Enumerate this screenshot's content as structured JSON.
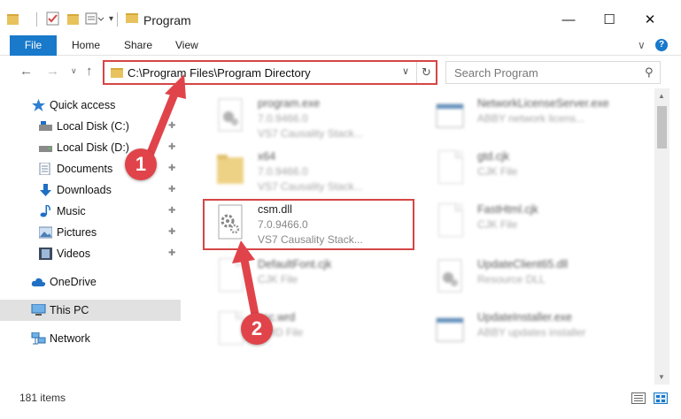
{
  "window": {
    "title": "Program",
    "minimize_label": "—",
    "maximize_label": "☐",
    "close_label": "✕"
  },
  "ribbon": {
    "file_label": "File",
    "tabs": [
      "Home",
      "Share",
      "View"
    ],
    "expand_label": "∨",
    "help_label": "?"
  },
  "nav": {
    "back_label": "←",
    "forward_label": "→",
    "recent_label": "∨",
    "up_label": "↑",
    "address": "C:\\Program Files\\Program Directory",
    "dropdown_label": "∨",
    "refresh_label": "↻",
    "search_placeholder": "Search Program",
    "search_icon_label": "⚲"
  },
  "sidebar": {
    "items": [
      {
        "label": "Quick access",
        "icon": "star-icon"
      },
      {
        "label": "Local Disk (C:)",
        "icon": "drive-icon"
      },
      {
        "label": "Local Disk (D:)",
        "icon": "drive-icon"
      },
      {
        "label": "Documents",
        "icon": "documents-icon"
      },
      {
        "label": "Downloads",
        "icon": "download-icon"
      },
      {
        "label": "Music",
        "icon": "music-icon"
      },
      {
        "label": "Pictures",
        "icon": "pictures-icon"
      },
      {
        "label": "Videos",
        "icon": "videos-icon"
      },
      {
        "label": "OneDrive",
        "icon": "cloud-icon"
      },
      {
        "label": "This PC",
        "icon": "computer-icon"
      },
      {
        "label": "Network",
        "icon": "network-icon"
      }
    ],
    "pin_label": "📌"
  },
  "files": {
    "left": [
      {
        "name": "program.exe",
        "line2": "7.0.9466.0",
        "line3": "VS7 Causality Stack..."
      },
      {
        "name": "x64",
        "line2": "7.0.9466.0",
        "line3": "VS7 Causality Stack..."
      },
      {
        "name": "csm.dll",
        "line2": "7.0.9466.0",
        "line3": "VS7 Causality Stack..."
      },
      {
        "name": "DefaultFont.cjk",
        "line2": "CJK File",
        "line3": ""
      },
      {
        "name": "ssc.wrd",
        "line2": "WRD File",
        "line3": ""
      }
    ],
    "right": [
      {
        "name": "NetworkLicenseServer.exe",
        "line2": "ABBY network licens...",
        "line3": ""
      },
      {
        "name": "gtd.cjk",
        "line2": "CJK File",
        "line3": ""
      },
      {
        "name": "FastHtml.cjk",
        "line2": "CJK File",
        "line3": ""
      },
      {
        "name": "UpdateClient65.dll",
        "line2": "Resource DLL",
        "line3": ""
      },
      {
        "name": "UpdateInstaller.exe",
        "line2": "ABBY updates installer",
        "line3": ""
      }
    ]
  },
  "callouts": {
    "one": "1",
    "two": "2",
    "color": "#e0444a"
  },
  "status": {
    "item_count": "181 items"
  },
  "colors": {
    "accent": "#1979ca",
    "highlight": "#d64545"
  }
}
